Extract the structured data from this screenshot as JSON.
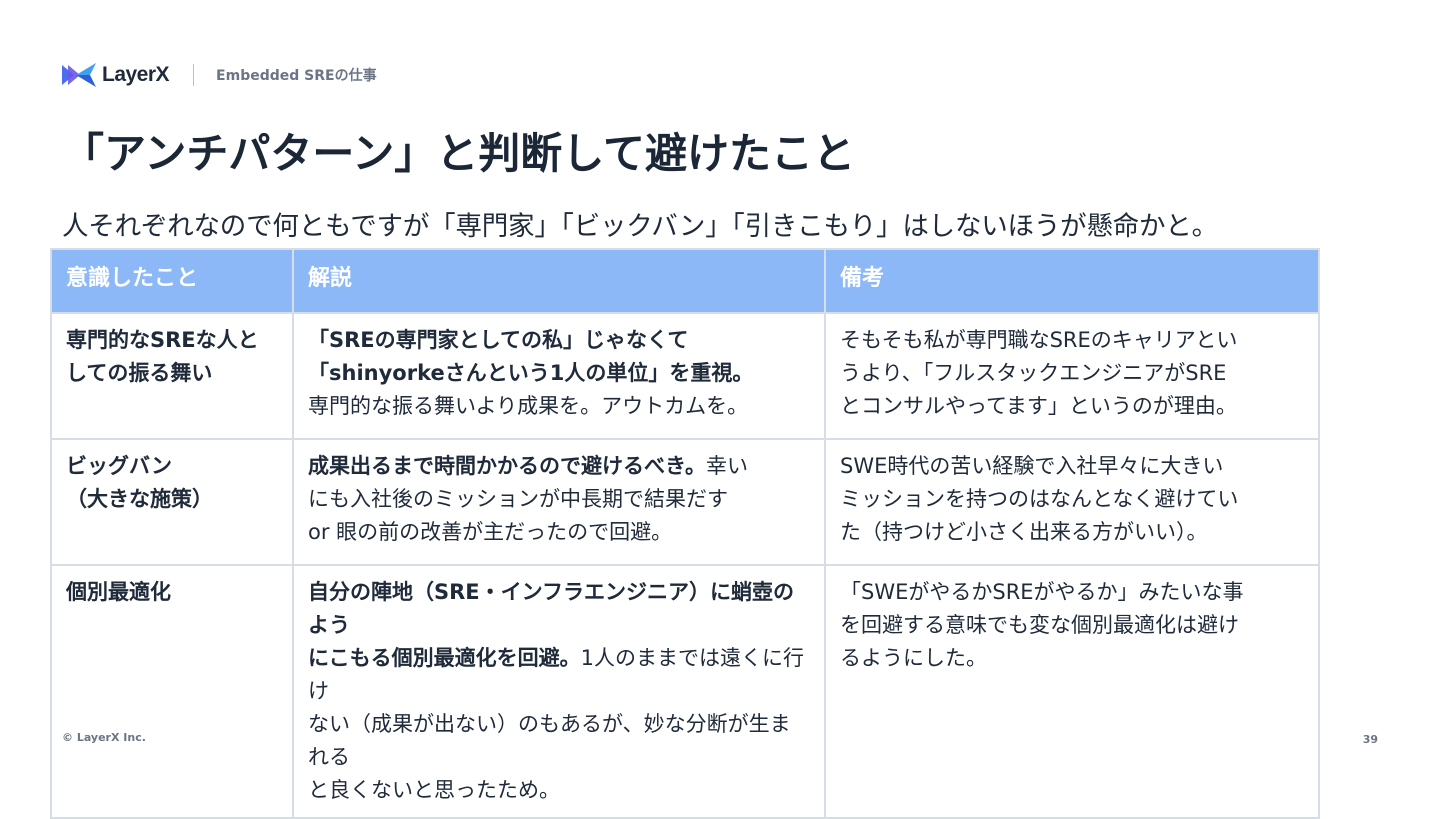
{
  "header": {
    "logo_text": "LayerX",
    "section": "Embedded SREの仕事"
  },
  "title": "「アンチパターン」と判断して避けたこと",
  "subtitle": "人それぞれなので何ともですが「専門家」「ビックバン」「引きこもり」はしないほうが懸命かと。",
  "table": {
    "headers": [
      "意識したこと",
      "解説",
      "備考"
    ],
    "rows": [
      {
        "item": [
          "専門的なSREな人と",
          "しての振る舞い"
        ],
        "explanation_bold": [
          "「SREの専門家としての私」じゃなくて",
          "「shinyorkeさんという1人の単位」を重視。"
        ],
        "explanation_rest": "専門的な振る舞いより成果を。アウトカムを。",
        "note": [
          "そもそも私が専門職なSREのキャリアとい",
          "うより、「フルスタックエンジニアがSRE",
          "とコンサルやってます」というのが理由。"
        ]
      },
      {
        "item": [
          "ビッグバン",
          "（大きな施策）"
        ],
        "explanation_bold": "成果出るまで時間かかるので避けるべき。",
        "explanation_rest": [
          "幸い",
          "にも入社後のミッションが中長期で結果だす",
          "or 眼の前の改善が主だったので回避。"
        ],
        "note": [
          "SWE時代の苦い経験で入社早々に大きい",
          "ミッションを持つのはなんとなく避けてい",
          "た（持つけど小さく出来る方がいい）。"
        ]
      },
      {
        "item": [
          "個別最適化"
        ],
        "explanation_bold": [
          "自分の陣地（SRE・インフラエンジニア）に蛸壺のよう",
          "にこもる個別最適化を回避。"
        ],
        "explanation_rest": [
          "1人のままでは遠くに行け",
          "ない（成果が出ない）のもあるが、妙な分断が生まれる",
          "と良くないと思ったため。"
        ],
        "note": [
          "「SWEがやるかSREがやるか」みたいな事",
          "を回避する意味でも変な個別最適化は避け",
          "るようにした。"
        ]
      }
    ]
  },
  "footer": {
    "copyright": "© LayerX Inc.",
    "page_number": "39"
  },
  "colors": {
    "header_row": "#8cb8f8",
    "title_text": "#1b2637",
    "muted_text": "#6b7585",
    "logo_blue": "#3d6fe0",
    "logo_purple": "#7a4fe0"
  }
}
